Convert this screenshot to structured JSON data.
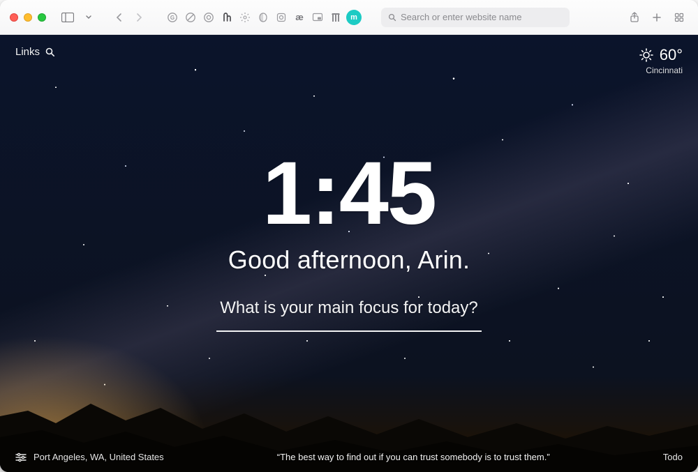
{
  "browser": {
    "address_placeholder": "Search or enter website name"
  },
  "top": {
    "links_label": "Links"
  },
  "weather": {
    "temp": "60°",
    "city": "Cincinnati"
  },
  "center": {
    "time": "1:45",
    "greeting": "Good afternoon, Arin.",
    "focus_prompt": "What is your main focus for today?"
  },
  "bottom": {
    "location": "Port Angeles, WA, United States",
    "quote": "“The best way to find out if you can trust somebody is to trust them.”",
    "todo_label": "Todo"
  }
}
